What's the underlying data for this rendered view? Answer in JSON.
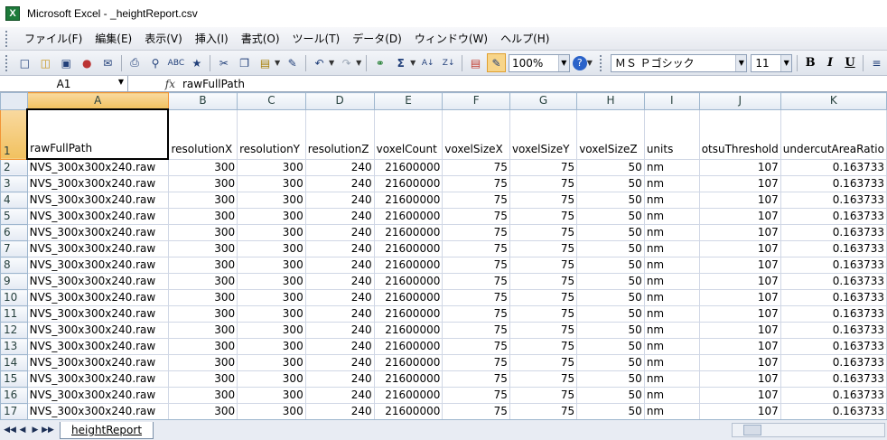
{
  "window": {
    "title": "Microsoft Excel - _heightReport.csv",
    "app_icon": "X"
  },
  "menu": [
    "ファイル(F)",
    "編集(E)",
    "表示(V)",
    "挿入(I)",
    "書式(O)",
    "ツール(T)",
    "データ(D)",
    "ウィンドウ(W)",
    "ヘルプ(H)"
  ],
  "toolbar": {
    "zoom": "100%",
    "font_name": "ＭＳ Ｐゴシック",
    "font_size": "11",
    "bold": "B",
    "italic": "I",
    "underline": "U"
  },
  "formula_bar": {
    "name_box": "A1",
    "fx": "fx",
    "content": "rawFullPath"
  },
  "columns": [
    "A",
    "B",
    "C",
    "D",
    "E",
    "F",
    "G",
    "H",
    "I",
    "J",
    "K"
  ],
  "header_row": {
    "row_number": "1",
    "cells": [
      "rawFullPath",
      "resolutionX",
      "resolutionY",
      "resolutionZ",
      "voxelCount",
      "voxelSizeX",
      "voxelSizeY",
      "voxelSizeZ",
      "units",
      "otsuThreshold",
      "undercutAreaRatio"
    ]
  },
  "rows": [
    {
      "n": "2",
      "cells": [
        "NVS_300x300x240.raw",
        "300",
        "300",
        "240",
        "21600000",
        "75",
        "75",
        "50",
        "nm",
        "107",
        "0.163733"
      ]
    },
    {
      "n": "3",
      "cells": [
        "NVS_300x300x240.raw",
        "300",
        "300",
        "240",
        "21600000",
        "75",
        "75",
        "50",
        "nm",
        "107",
        "0.163733"
      ]
    },
    {
      "n": "4",
      "cells": [
        "NVS_300x300x240.raw",
        "300",
        "300",
        "240",
        "21600000",
        "75",
        "75",
        "50",
        "nm",
        "107",
        "0.163733"
      ]
    },
    {
      "n": "5",
      "cells": [
        "NVS_300x300x240.raw",
        "300",
        "300",
        "240",
        "21600000",
        "75",
        "75",
        "50",
        "nm",
        "107",
        "0.163733"
      ]
    },
    {
      "n": "6",
      "cells": [
        "NVS_300x300x240.raw",
        "300",
        "300",
        "240",
        "21600000",
        "75",
        "75",
        "50",
        "nm",
        "107",
        "0.163733"
      ]
    },
    {
      "n": "7",
      "cells": [
        "NVS_300x300x240.raw",
        "300",
        "300",
        "240",
        "21600000",
        "75",
        "75",
        "50",
        "nm",
        "107",
        "0.163733"
      ]
    },
    {
      "n": "8",
      "cells": [
        "NVS_300x300x240.raw",
        "300",
        "300",
        "240",
        "21600000",
        "75",
        "75",
        "50",
        "nm",
        "107",
        "0.163733"
      ]
    },
    {
      "n": "9",
      "cells": [
        "NVS_300x300x240.raw",
        "300",
        "300",
        "240",
        "21600000",
        "75",
        "75",
        "50",
        "nm",
        "107",
        "0.163733"
      ]
    },
    {
      "n": "10",
      "cells": [
        "NVS_300x300x240.raw",
        "300",
        "300",
        "240",
        "21600000",
        "75",
        "75",
        "50",
        "nm",
        "107",
        "0.163733"
      ]
    },
    {
      "n": "11",
      "cells": [
        "NVS_300x300x240.raw",
        "300",
        "300",
        "240",
        "21600000",
        "75",
        "75",
        "50",
        "nm",
        "107",
        "0.163733"
      ]
    },
    {
      "n": "12",
      "cells": [
        "NVS_300x300x240.raw",
        "300",
        "300",
        "240",
        "21600000",
        "75",
        "75",
        "50",
        "nm",
        "107",
        "0.163733"
      ]
    },
    {
      "n": "13",
      "cells": [
        "NVS_300x300x240.raw",
        "300",
        "300",
        "240",
        "21600000",
        "75",
        "75",
        "50",
        "nm",
        "107",
        "0.163733"
      ]
    },
    {
      "n": "14",
      "cells": [
        "NVS_300x300x240.raw",
        "300",
        "300",
        "240",
        "21600000",
        "75",
        "75",
        "50",
        "nm",
        "107",
        "0.163733"
      ]
    },
    {
      "n": "15",
      "cells": [
        "NVS_300x300x240.raw",
        "300",
        "300",
        "240",
        "21600000",
        "75",
        "75",
        "50",
        "nm",
        "107",
        "0.163733"
      ]
    },
    {
      "n": "16",
      "cells": [
        "NVS_300x300x240.raw",
        "300",
        "300",
        "240",
        "21600000",
        "75",
        "75",
        "50",
        "nm",
        "107",
        "0.163733"
      ]
    },
    {
      "n": "17",
      "cells": [
        "NVS_300x300x240.raw",
        "300",
        "300",
        "240",
        "21600000",
        "75",
        "75",
        "50",
        "nm",
        "107",
        "0.163733"
      ]
    }
  ],
  "sheet_tabs": [
    "heightReport"
  ],
  "colors": {
    "selected_header": "#f1c15f",
    "grid_line": "#d0d7e5",
    "header_bg": "#e4eaf3"
  }
}
